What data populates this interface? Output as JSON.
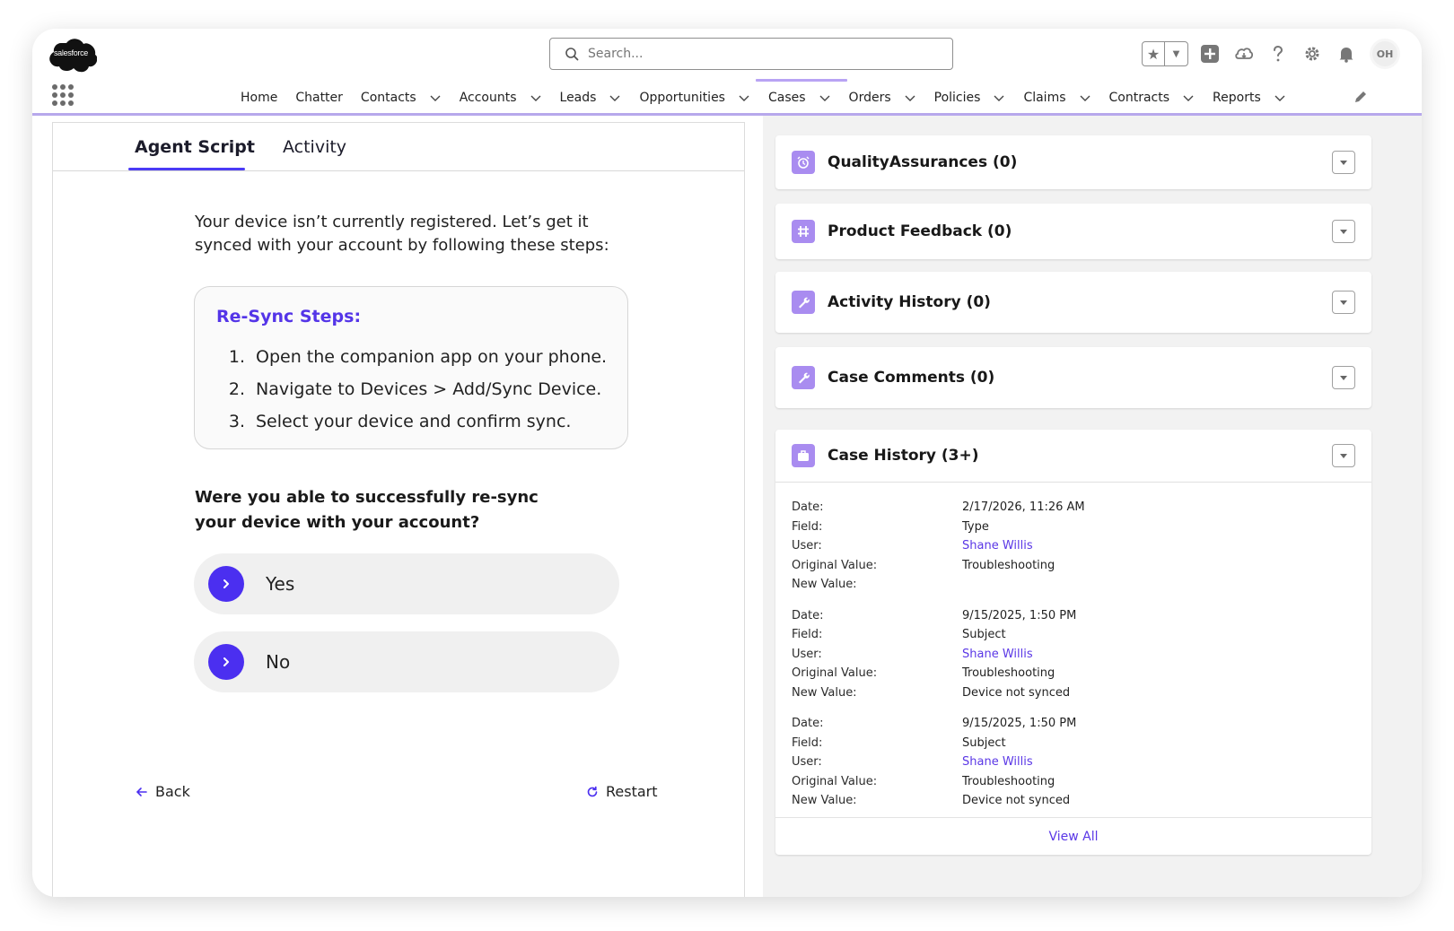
{
  "header": {
    "logo_text": "salesforce",
    "search_placeholder": "Search...",
    "avatar_initials": "OH",
    "nav": [
      {
        "label": "Home",
        "has_menu": false
      },
      {
        "label": "Chatter",
        "has_menu": false
      },
      {
        "label": "Contacts",
        "has_menu": true
      },
      {
        "label": "Accounts",
        "has_menu": true
      },
      {
        "label": "Leads",
        "has_menu": true
      },
      {
        "label": "Opportunities",
        "has_menu": true
      },
      {
        "label": "Cases",
        "has_menu": true,
        "active": true
      },
      {
        "label": "Orders",
        "has_menu": true
      },
      {
        "label": "Policies",
        "has_menu": true
      },
      {
        "label": "Claims",
        "has_menu": true
      },
      {
        "label": "Contracts",
        "has_menu": true
      },
      {
        "label": "Reports",
        "has_menu": true
      }
    ]
  },
  "agent": {
    "tabs": [
      "Agent Script",
      "Activity"
    ],
    "intro": "Your device isn’t currently registered. Let’s get it synced with your account by following these steps:",
    "steps_title": "Re-Sync Steps:",
    "steps": [
      {
        "num": "1.",
        "text": "Open the companion app on your phone."
      },
      {
        "num": "2.",
        "text": "Navigate to Devices > Add/Sync Device."
      },
      {
        "num": "3.",
        "text": "Select your device and confirm sync."
      }
    ],
    "question": "Were you able to successfully re-sync your device with your account?",
    "choices": [
      "Yes",
      "No"
    ],
    "back_label": "Back",
    "restart_label": "Restart"
  },
  "related": {
    "cards": [
      {
        "title": "QualityAssurances (0)",
        "icon": "alarm-clock-icon"
      },
      {
        "title": "Product Feedback (0)",
        "icon": "hashtag-icon"
      },
      {
        "title": "Activity History (0)",
        "icon": "wrench-icon"
      },
      {
        "title": "Case Comments (0)",
        "icon": "wrench-icon"
      },
      {
        "title": "Case History (3+)",
        "icon": "briefcase-icon"
      }
    ],
    "history_labels": {
      "date": "Date:",
      "field": "Field:",
      "user": "User:",
      "original": "Original Value:",
      "new": "New Value:"
    },
    "history": [
      {
        "date": "2/17/2026, 11:26 AM",
        "field": "Type",
        "user": "Shane Willis",
        "original": "Troubleshooting",
        "new": ""
      },
      {
        "date": "9/15/2025, 1:50 PM",
        "field": "Subject",
        "user": "Shane Willis",
        "original": "Troubleshooting",
        "new": "Device not synced"
      },
      {
        "date": "9/15/2025, 1:50 PM",
        "field": "Subject",
        "user": "Shane Willis",
        "original": "Troubleshooting",
        "new": "Device not synced"
      }
    ],
    "view_all": "View All"
  },
  "colors": {
    "accent": "#4b2ff0",
    "accent_text": "#5435e8",
    "icon_bg": "#a98cf0",
    "salesforce_blue": "#00a1e0",
    "logo_fill": "#111111"
  }
}
